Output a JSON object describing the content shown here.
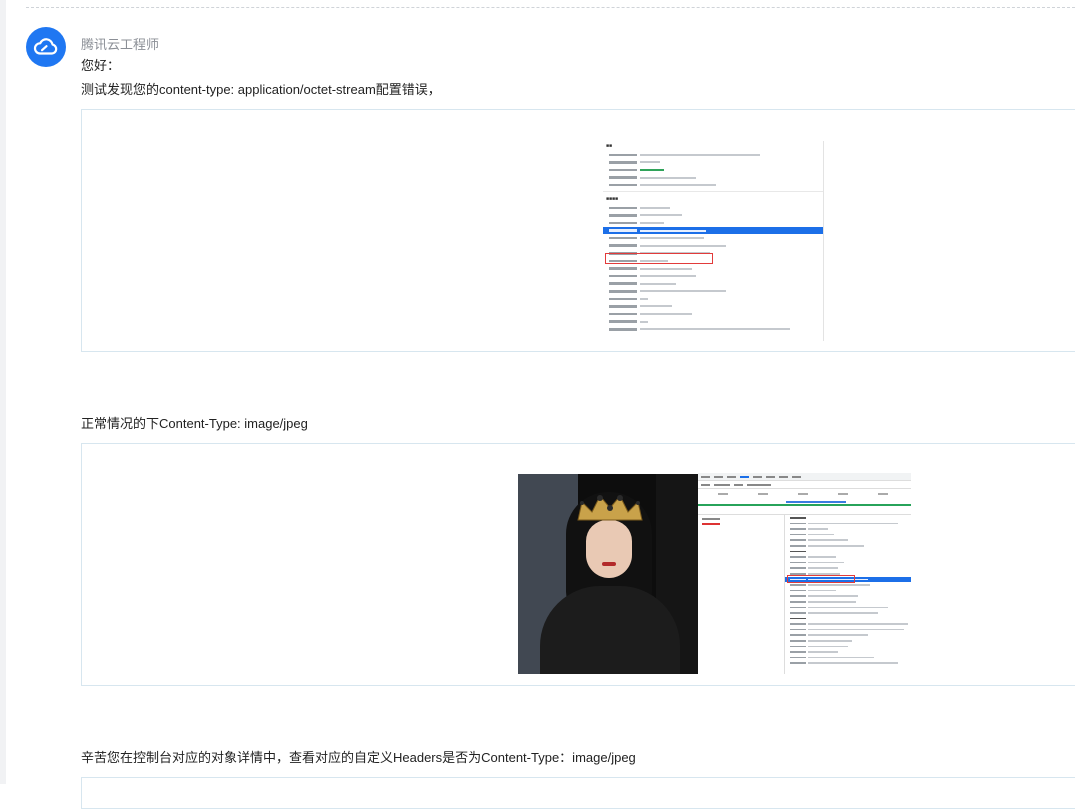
{
  "message": {
    "sender": "腾讯云工程师",
    "greeting": "您好：",
    "paragraph_1": "测试发现您的content-type: application/octet-stream配置错误，",
    "paragraph_2": "正常情况的下Content-Type: image/jpeg",
    "paragraph_3": "辛苦您在控制台对应的对象详情中，查看对应的自定义Headers是否为Content-Type：image/jpeg"
  },
  "icons": {
    "avatar": "tencent-cloud-logo-icon"
  },
  "colors": {
    "avatar_bg": "#1f77f2",
    "sender_text": "#8b8f96",
    "frame_border": "#d7e6ef",
    "highlight_row": "#1c6fe8",
    "annotation_box": "#e23b3b"
  }
}
